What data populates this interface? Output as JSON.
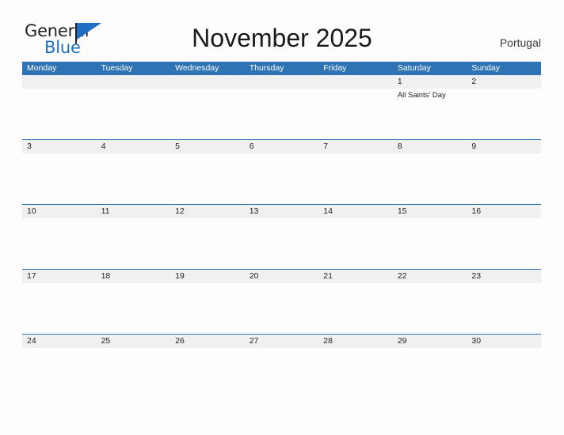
{
  "brand": {
    "name_part1": "General",
    "name_part2": "Blue",
    "flag_icon": "flag-triangle-icon"
  },
  "header": {
    "title": "November 2025",
    "region": "Portugal"
  },
  "calendar": {
    "weekdays": [
      "Monday",
      "Tuesday",
      "Wednesday",
      "Thursday",
      "Friday",
      "Saturday",
      "Sunday"
    ],
    "colors": {
      "header_blue": "#2e74b5",
      "date_band_gray": "#f0f0f0",
      "brand_blue": "#1f6fc4",
      "text": "#222222"
    },
    "weeks": [
      [
        {
          "day": "",
          "events": []
        },
        {
          "day": "",
          "events": []
        },
        {
          "day": "",
          "events": []
        },
        {
          "day": "",
          "events": []
        },
        {
          "day": "",
          "events": []
        },
        {
          "day": "1",
          "events": [
            "All Saints' Day"
          ]
        },
        {
          "day": "2",
          "events": []
        }
      ],
      [
        {
          "day": "3",
          "events": []
        },
        {
          "day": "4",
          "events": []
        },
        {
          "day": "5",
          "events": []
        },
        {
          "day": "6",
          "events": []
        },
        {
          "day": "7",
          "events": []
        },
        {
          "day": "8",
          "events": []
        },
        {
          "day": "9",
          "events": []
        }
      ],
      [
        {
          "day": "10",
          "events": []
        },
        {
          "day": "11",
          "events": []
        },
        {
          "day": "12",
          "events": []
        },
        {
          "day": "13",
          "events": []
        },
        {
          "day": "14",
          "events": []
        },
        {
          "day": "15",
          "events": []
        },
        {
          "day": "16",
          "events": []
        }
      ],
      [
        {
          "day": "17",
          "events": []
        },
        {
          "day": "18",
          "events": []
        },
        {
          "day": "19",
          "events": []
        },
        {
          "day": "20",
          "events": []
        },
        {
          "day": "21",
          "events": []
        },
        {
          "day": "22",
          "events": []
        },
        {
          "day": "23",
          "events": []
        }
      ],
      [
        {
          "day": "24",
          "events": []
        },
        {
          "day": "25",
          "events": []
        },
        {
          "day": "26",
          "events": []
        },
        {
          "day": "27",
          "events": []
        },
        {
          "day": "28",
          "events": []
        },
        {
          "day": "29",
          "events": []
        },
        {
          "day": "30",
          "events": []
        }
      ]
    ]
  }
}
